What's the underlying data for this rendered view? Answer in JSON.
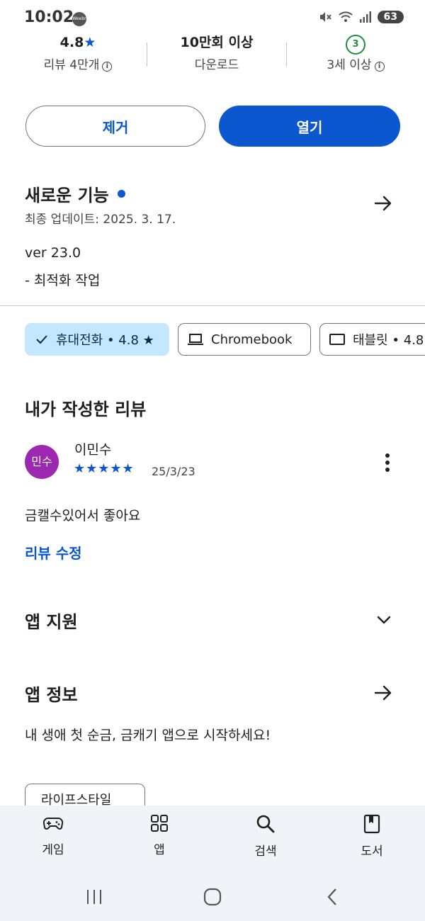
{
  "status_bar": {
    "time": "10:02",
    "app_badge": "Weebr",
    "battery": "63"
  },
  "stats": {
    "rating_value": "4.8",
    "rating_star": "★",
    "reviews_label": "리뷰 4만개",
    "downloads_value": "10만회 이상",
    "downloads_label": "다운로드",
    "age_badge": "3",
    "age_label": "3세 이상",
    "info_glyph": "i"
  },
  "actions": {
    "uninstall_label": "제거",
    "open_label": "열기"
  },
  "whats_new": {
    "title": "새로운 기능",
    "updated": "최종 업데이트: 2025. 3. 17.",
    "version": "ver 23.0",
    "notes": "- 최적화 작업"
  },
  "device_chips": {
    "phone": "휴대전화 • 4.8 ★",
    "chromebook": "Chromebook",
    "tablet": "태블릿 • 4.8"
  },
  "my_review": {
    "section_title": "내가 작성한 리뷰",
    "avatar_text": "민수",
    "reviewer": "이민수",
    "stars": "★★★★★",
    "date": "25/3/23",
    "text": "금캘수있어서 좋아요",
    "edit_label": "리뷰 수정"
  },
  "app_support": {
    "title": "앱 지원"
  },
  "app_info": {
    "title": "앱 정보",
    "description": "내 생애 첫 순금, 금캐기 앱으로 시작하세요!",
    "category": "라이프스타일"
  },
  "bottom_nav": [
    {
      "label": "게임",
      "icon": "gamepad-icon"
    },
    {
      "label": "앱",
      "icon": "apps-grid-icon"
    },
    {
      "label": "검색",
      "icon": "search-icon"
    },
    {
      "label": "도서",
      "icon": "book-icon"
    }
  ],
  "colors": {
    "accent": "#0b57d0",
    "chip_selected": "#c2e7ff",
    "avatar": "#9c27b0",
    "nav_bg": "#f0f4f9"
  }
}
